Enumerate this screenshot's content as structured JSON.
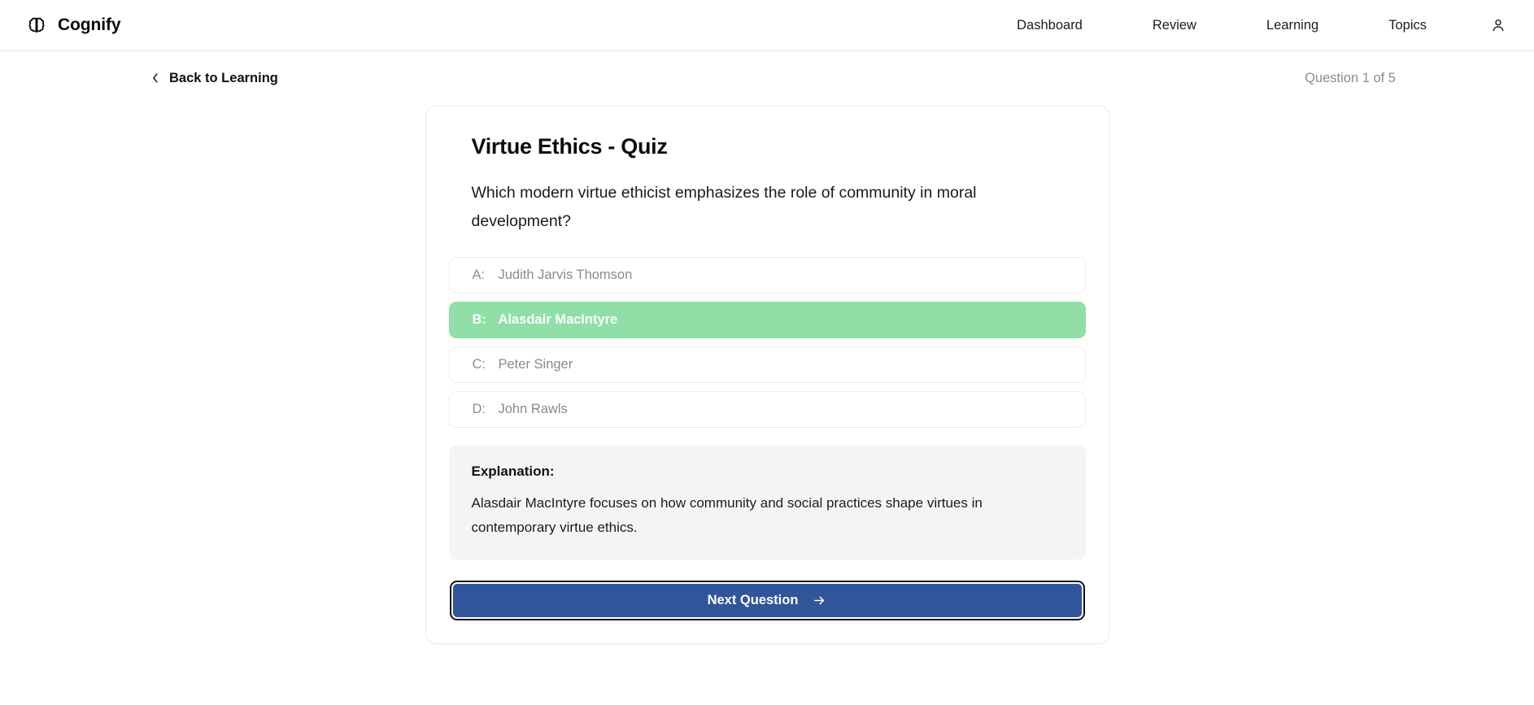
{
  "header": {
    "brand_name": "Cognify",
    "brand_icon": "brain-icon",
    "nav_items": [
      {
        "label": "Dashboard"
      },
      {
        "label": "Review"
      },
      {
        "label": "Learning"
      },
      {
        "label": "Topics"
      }
    ],
    "user_icon": "user-account-icon"
  },
  "subheader": {
    "back_label": "Back to Learning",
    "back_icon": "chevron-left-icon",
    "question_counter": "Question 1 of 5"
  },
  "quiz": {
    "title": "Virtue Ethics - Quiz",
    "question": "Which modern virtue ethicist emphasizes the role of community in moral development?",
    "options": [
      {
        "letter": "A:",
        "text": "Judith Jarvis Thomson",
        "selected": false
      },
      {
        "letter": "B:",
        "text": "Alasdair MacIntyre",
        "selected": true
      },
      {
        "letter": "C:",
        "text": "Peter Singer",
        "selected": false
      },
      {
        "letter": "D:",
        "text": "John Rawls",
        "selected": false
      }
    ],
    "explanation_label": "Explanation:",
    "explanation_body": "Alasdair MacIntyre focuses on how community and social practices shape virtues in contemporary virtue ethics.",
    "next_label": "Next Question",
    "next_icon": "arrow-right-icon"
  },
  "colors": {
    "correct_green": "#8fdfa7",
    "primary_blue": "#31559a",
    "explanation_bg": "#f4f4f4",
    "muted_text": "#8b8b8b",
    "border": "#ebebeb"
  }
}
